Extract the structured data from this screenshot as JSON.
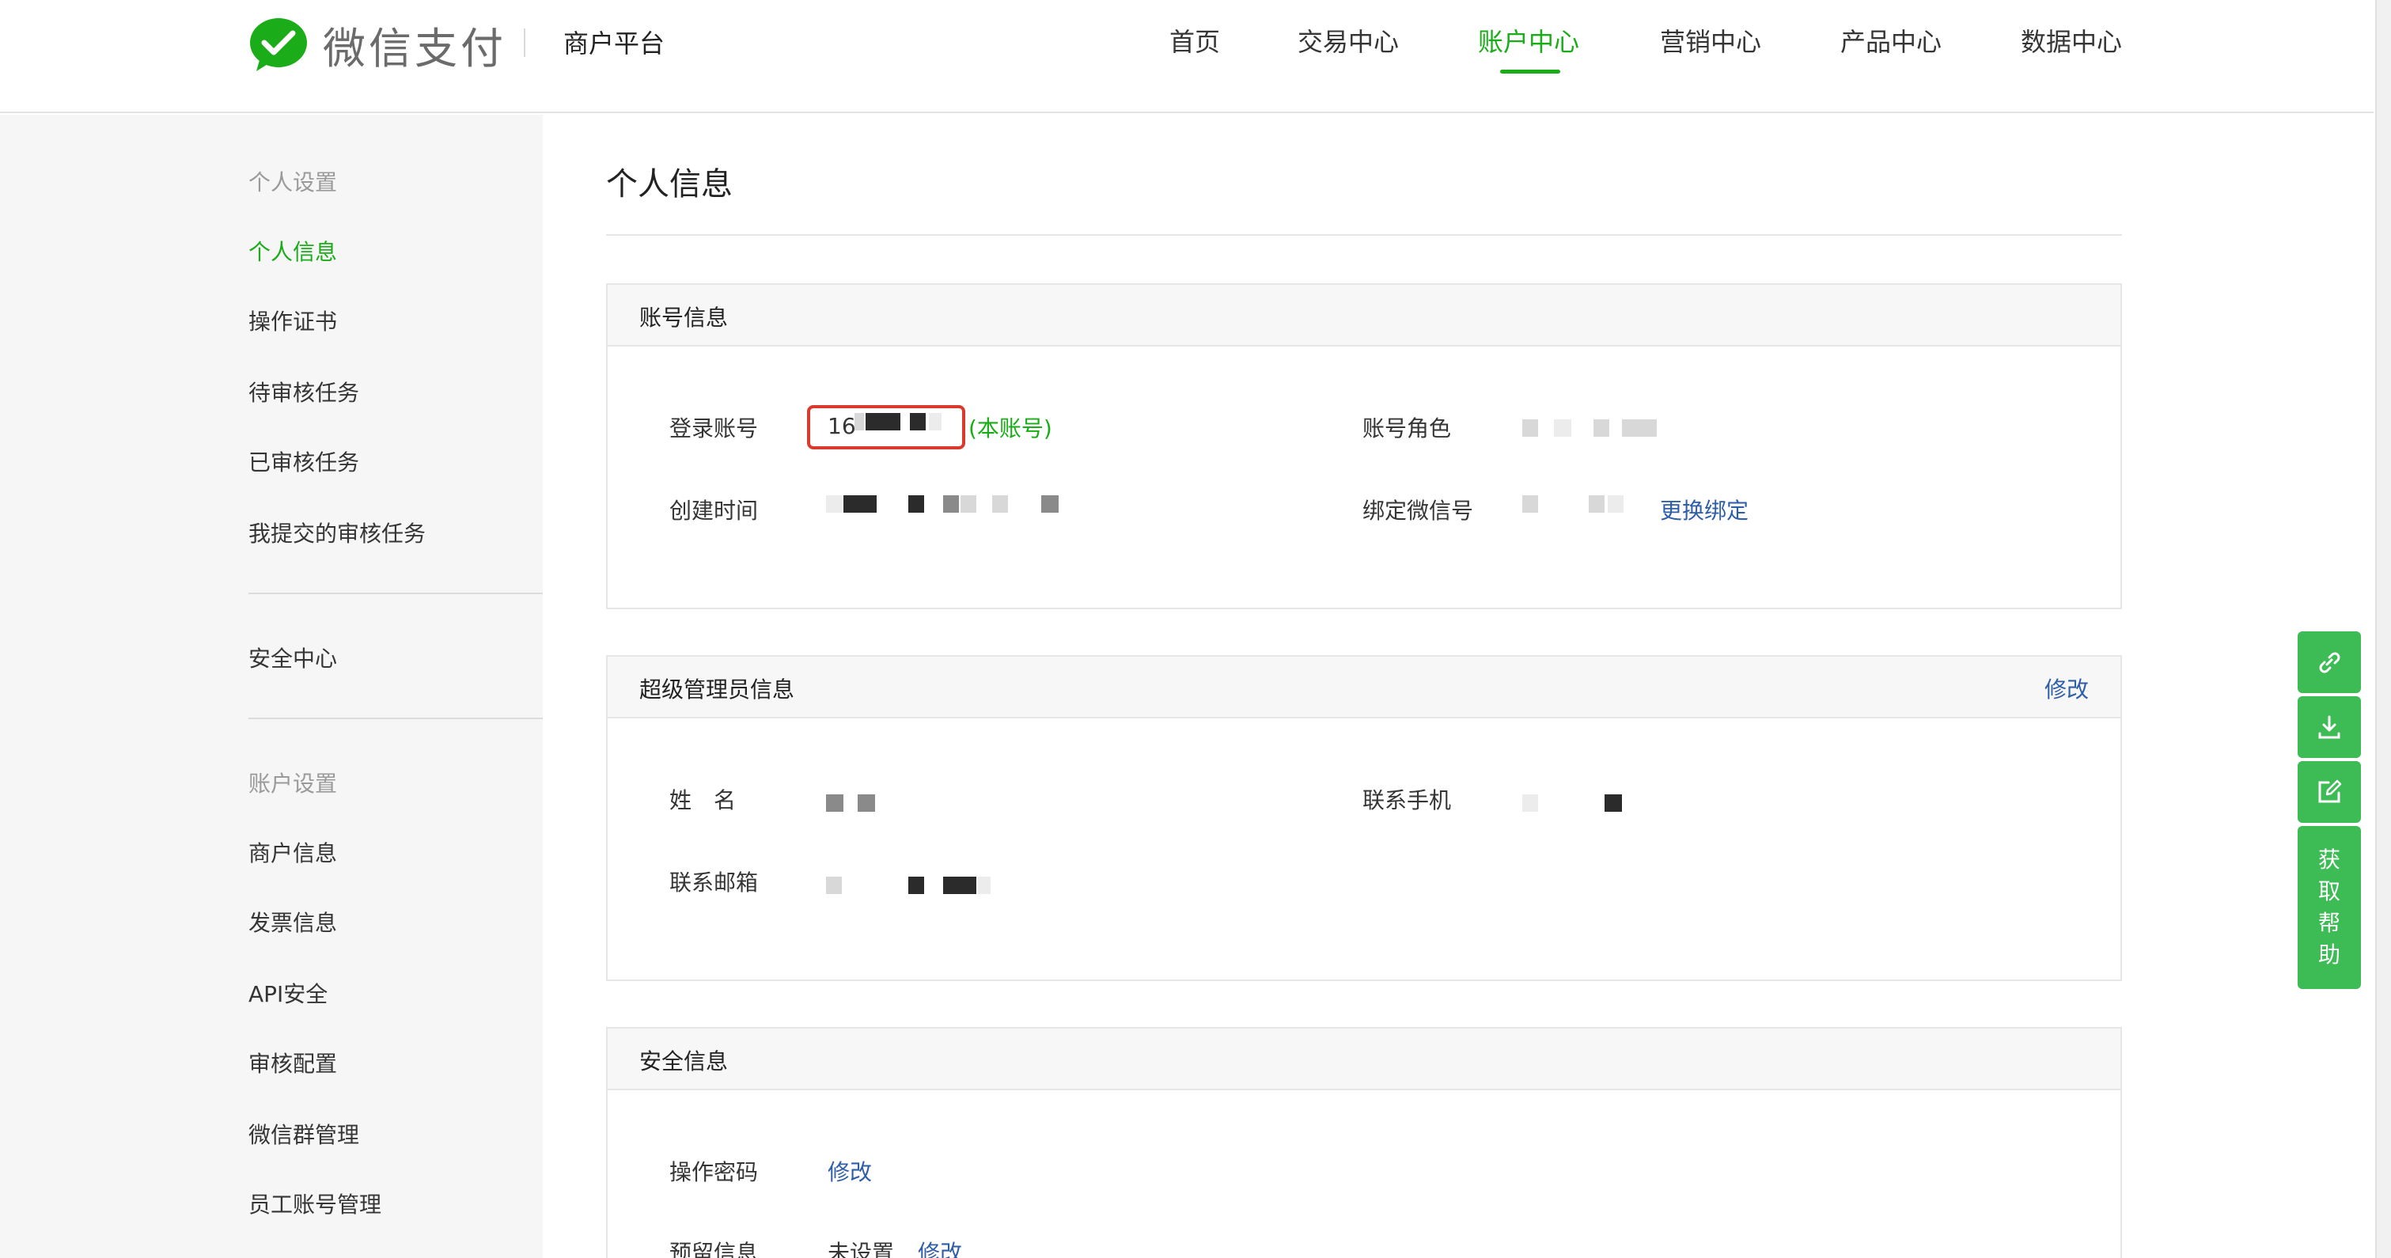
{
  "header": {
    "logo_text": "微信支付",
    "platform": "商户平台",
    "nav": [
      {
        "label": "首页",
        "active": false
      },
      {
        "label": "交易中心",
        "active": false
      },
      {
        "label": "账户中心",
        "active": true
      },
      {
        "label": "营销中心",
        "active": false
      },
      {
        "label": "产品中心",
        "active": false
      },
      {
        "label": "数据中心",
        "active": false
      }
    ]
  },
  "sidebar": {
    "group_personal": "个人设置",
    "personal_items": [
      "个人信息",
      "操作证书",
      "待审核任务",
      "已审核任务",
      "我提交的审核任务"
    ],
    "security": "安全中心",
    "group_account": "账户设置",
    "account_items": [
      "商户信息",
      "发票信息",
      "API安全",
      "审核配置",
      "微信群管理",
      "员工账号管理"
    ]
  },
  "main": {
    "title": "个人信息",
    "account_card": {
      "title": "账号信息",
      "login_label": "登录账号",
      "login_value": "16",
      "login_note": "(本账号)",
      "role_label": "账号角色",
      "created_label": "创建时间",
      "wechat_label": "绑定微信号",
      "rebind_link": "更换绑定"
    },
    "admin_card": {
      "title": "超级管理员信息",
      "edit_link": "修改",
      "name_label": "姓　名",
      "phone_label": "联系手机",
      "email_label": "联系邮箱"
    },
    "security_card": {
      "title": "安全信息",
      "password_label": "操作密码",
      "password_link": "修改",
      "reserved_label": "预留信息",
      "reserved_value": "未设置",
      "reserved_link": "修改"
    }
  },
  "float_tools": {
    "help_chars": [
      "获",
      "取",
      "帮",
      "助"
    ]
  },
  "colors": {
    "brand_green": "#1aad19",
    "link_blue": "#2f5ea8",
    "highlight_red": "#d93a2b",
    "float_green": "#3dbb55"
  }
}
